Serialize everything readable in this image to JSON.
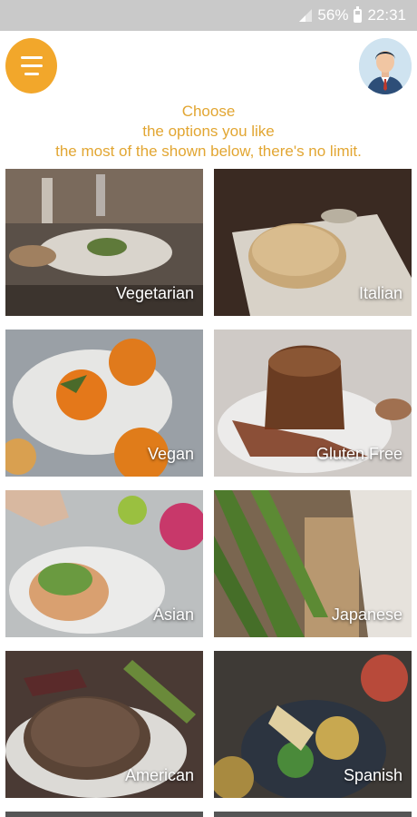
{
  "status_bar": {
    "battery_percent": "56%",
    "battery_level": 0.56,
    "time": "22:31",
    "icons": [
      "signal-icon",
      "battery-icon"
    ]
  },
  "header": {
    "menu_icon": "hamburger-menu-icon",
    "avatar_icon": "user-avatar-icon",
    "accent_color": "#f2a72b"
  },
  "intro": {
    "line1": "Choose",
    "line2": "the options you like",
    "line3": "the most of the shown below, there's no limit."
  },
  "categories": [
    {
      "label": "Vegetarian"
    },
    {
      "label": "Italian"
    },
    {
      "label": "Vegan"
    },
    {
      "label": "Gluten Free"
    },
    {
      "label": "Asian"
    },
    {
      "label": "Japanese"
    },
    {
      "label": "American"
    },
    {
      "label": "Spanish"
    }
  ]
}
